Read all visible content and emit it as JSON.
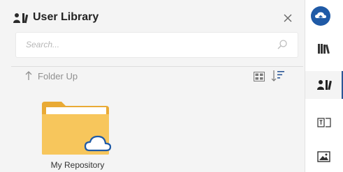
{
  "panel": {
    "title": "User Library",
    "title_icon": "user-library-icon",
    "close_icon": "close-icon"
  },
  "search": {
    "placeholder": "Search...",
    "value": "",
    "icon": "search-icon"
  },
  "toolbar": {
    "folder_up_label": "Folder Up",
    "folder_up_icon": "arrow-up-icon",
    "grid_view_icon": "grid-view-icon",
    "sort_icon": "sort-icon"
  },
  "items": [
    {
      "label": "My Repository",
      "icon": "cloud-folder-icon"
    }
  ],
  "rail": {
    "buttons": [
      {
        "icon": "cloud-badge-icon"
      },
      {
        "icon": "books-library-icon"
      },
      {
        "icon": "user-library-icon",
        "active": true
      },
      {
        "icon": "text-frame-icon"
      },
      {
        "icon": "image-icon"
      }
    ]
  },
  "colors": {
    "panel_bg": "#f4f4f4",
    "accent": "#1f5aa6",
    "folder": "#f7c65c",
    "folder_dark": "#e9aa35"
  }
}
